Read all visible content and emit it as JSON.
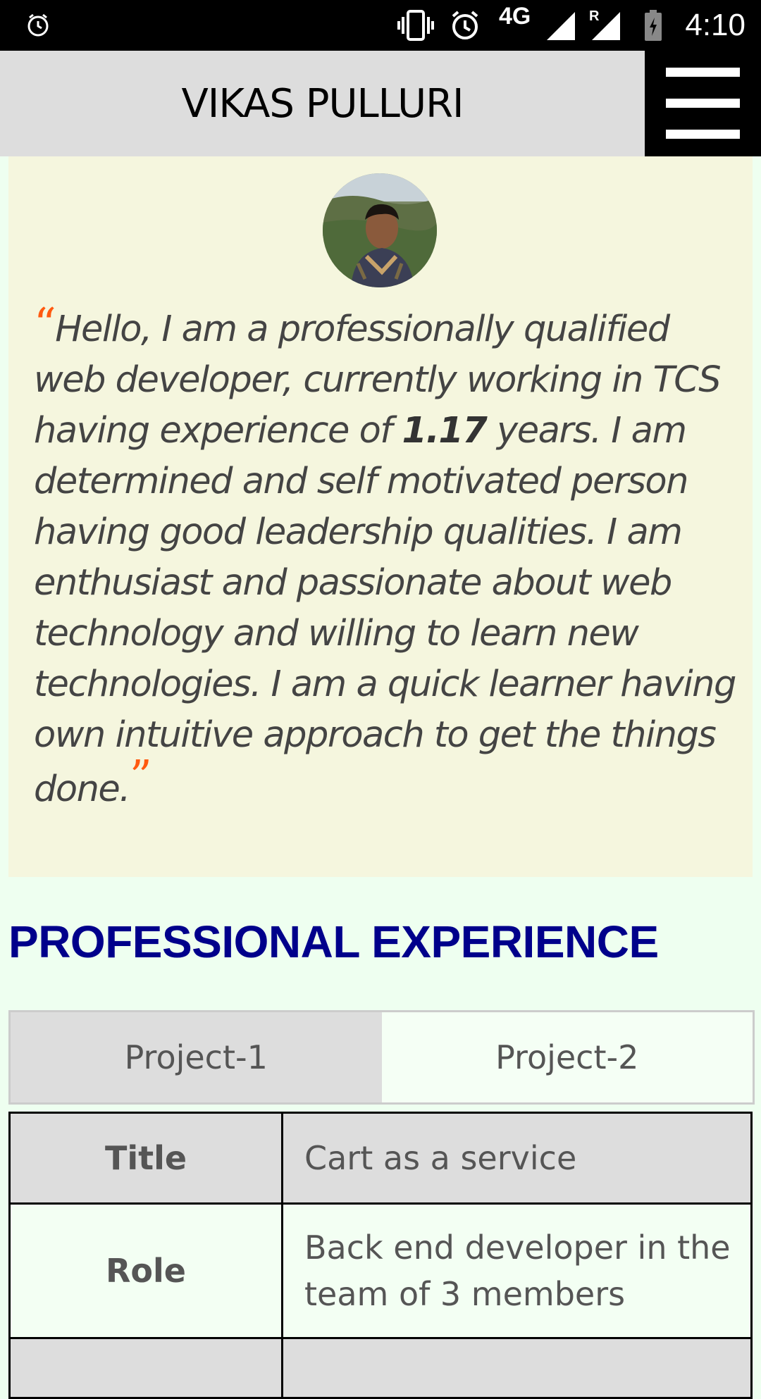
{
  "status_bar": {
    "time": "4:10",
    "network": "4G",
    "roaming": "R",
    "icons": [
      "alarm-clock-icon",
      "vibrate-icon",
      "alarm-icon",
      "signal-icon",
      "roaming-signal-icon",
      "battery-charging-icon"
    ]
  },
  "header": {
    "title": "VIKAS PULLURI",
    "menu_icon": "hamburger-menu-icon"
  },
  "intro": {
    "open_quote": "“",
    "text_before_years": "Hello, I am a professionally qualified web developer, currently working in TCS having experience of ",
    "years": "1.17",
    "text_after_years": " years. I am determined and self motivated person having good leadership qualities. I am enthusiast and passionate about web technology and willing to learn new technologies. I am a quick learner having own intuitive approach to get the things done.",
    "close_quote": "”"
  },
  "section": {
    "title": "PROFESSIONAL EXPERIENCE"
  },
  "tabs": [
    {
      "label": "Project-1",
      "active": true
    },
    {
      "label": "Project-2",
      "active": false
    }
  ],
  "project_table": {
    "rows": [
      {
        "key": "Title",
        "value": "Cart as a service"
      },
      {
        "key": "Role",
        "value": "Back end developer in the team of 3 members"
      },
      {
        "key": "",
        "value": ""
      }
    ]
  },
  "colors": {
    "header_bg": "#dddddd",
    "intro_bg": "#f5f6de",
    "page_bg": "#eefff0",
    "quote_mark": "#ff5a10",
    "section_title": "#00008b"
  }
}
